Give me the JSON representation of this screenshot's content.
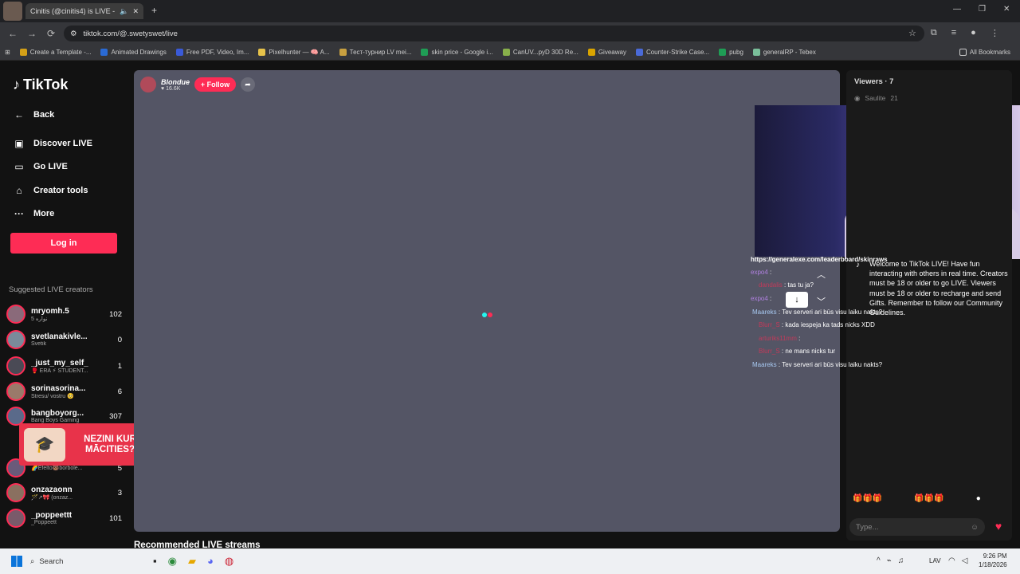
{
  "browser": {
    "tab_title": "Cinitis (@cinitis4) is LIVE - ",
    "url": "tiktok.com/@.swetyswet/live",
    "bookmarks": [
      "Create a Template -...",
      "Animated Drawings",
      "Free PDF, Video, Im...",
      "Pixelhunter — 🧠 A...",
      "Тест-турнир LV mei...",
      "skin price - Google i...",
      "CanUV...pyD 30D Re...",
      "Giveaway",
      "Counter-Strike Case...",
      "pubg",
      "generalRP - Tebex"
    ],
    "all_bookmarks": "All Bookmarks"
  },
  "sidebar": {
    "brand": "TikTok",
    "back": "Back",
    "discover": "Discover LIVE",
    "golive": "Go LIVE",
    "creator_tools": "Creator tools",
    "more": "More",
    "login": "Log in",
    "suggested_title": "Suggested LIVE creators",
    "creators": [
      {
        "name": "mryomh.5",
        "sub": "نواره 5",
        "count": "102"
      },
      {
        "name": "svetlanakivle...",
        "sub": "Svetik",
        "count": "0"
      },
      {
        "name": "_just_my_self_",
        "sub": "🥊 ERA ⚡ STUDENT...",
        "count": "1"
      },
      {
        "name": "sorinasorina...",
        "sub": "Stresu/ vostru 🥺",
        "count": "6"
      },
      {
        "name": "bangboyorg...",
        "sub": "Bang Boys Gaming",
        "count": "307"
      },
      {
        "name": "",
        "sub": "🌈Efelto🐻borbole...",
        "count": "5"
      },
      {
        "name": "onzazaonn",
        "sub": "🪄↗🎀 (onzaz...",
        "count": "3"
      },
      {
        "name": "_poppeettt",
        "sub": "_Poppeett",
        "count": "101"
      }
    ],
    "ad_text": "NEZINI KUR MĀCITIES?"
  },
  "player": {
    "host_name": "Blondue",
    "host_likes": "16.6K",
    "follow": "+ Follow"
  },
  "chat": {
    "url_line": "https://generalexe.com/leaderboard/skinraws",
    "messages": [
      {
        "user": "expo4",
        "text": ":"
      },
      {
        "user": "dandalis",
        "text": ": tas tu ja?"
      },
      {
        "user": "expo4",
        "text": ":"
      },
      {
        "user": "Maareks",
        "text": ": Tev serveri ari būs visu laiku nakts?"
      },
      {
        "user": "Blurr_S",
        "text": ": kada iespeja ka tads nicks XDD"
      },
      {
        "user": "arturiks11mm",
        "text": ":"
      },
      {
        "user": "Blurr_S",
        "text": ": ne mans nicks tur"
      },
      {
        "user": "Maareks",
        "text": ": Tev serveri ari būs visu laiku nakts?"
      }
    ]
  },
  "viewers": {
    "title": "Viewers · 7",
    "top_viewer": "Saulite",
    "top_viewer_score": "21",
    "welcome": "Welcome to TikTok LIVE! Have fun interacting with others in real time. Creators must be 18 or older to go LIVE. Viewers must be 18 or older to recharge and send Gifts. Remember to follow our Community Guidelines.",
    "type_placeholder": "Type..."
  },
  "main": {
    "recommended": "Recommended LIVE streams"
  },
  "taskbar": {
    "search": "Search",
    "lang": "LAV",
    "time": "9:26 PM",
    "date": "1/18/2026"
  }
}
